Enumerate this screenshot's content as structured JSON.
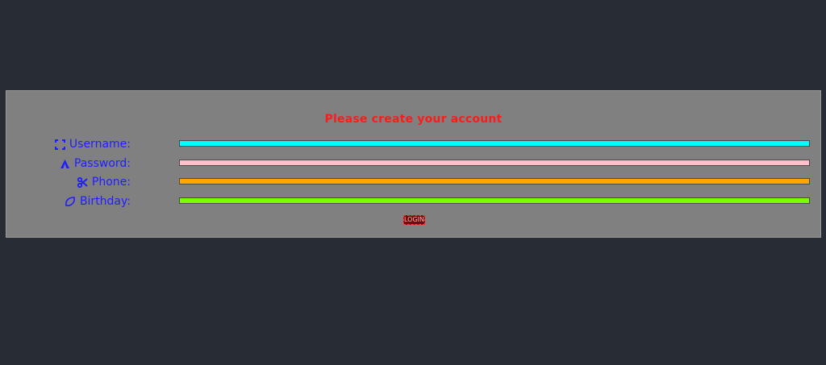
{
  "form": {
    "title": "Please create your account",
    "fields": [
      {
        "label": "Username:",
        "icon": "focus-frame-icon",
        "color": "#00ffff"
      },
      {
        "label": "Password:",
        "icon": "tent-icon",
        "color": "#ffc0cb"
      },
      {
        "label": "Phone:",
        "icon": "scissors-icon",
        "color": "#ffa500"
      },
      {
        "label": "Birthday:",
        "icon": "leaf-icon",
        "color": "#7cfc00"
      }
    ],
    "login_label": "LOGIN"
  },
  "colors": {
    "background": "#282c34",
    "panel": "#808080",
    "title": "#ff1a1a",
    "label": "#1e1eff",
    "button_border": "#ff3030"
  }
}
